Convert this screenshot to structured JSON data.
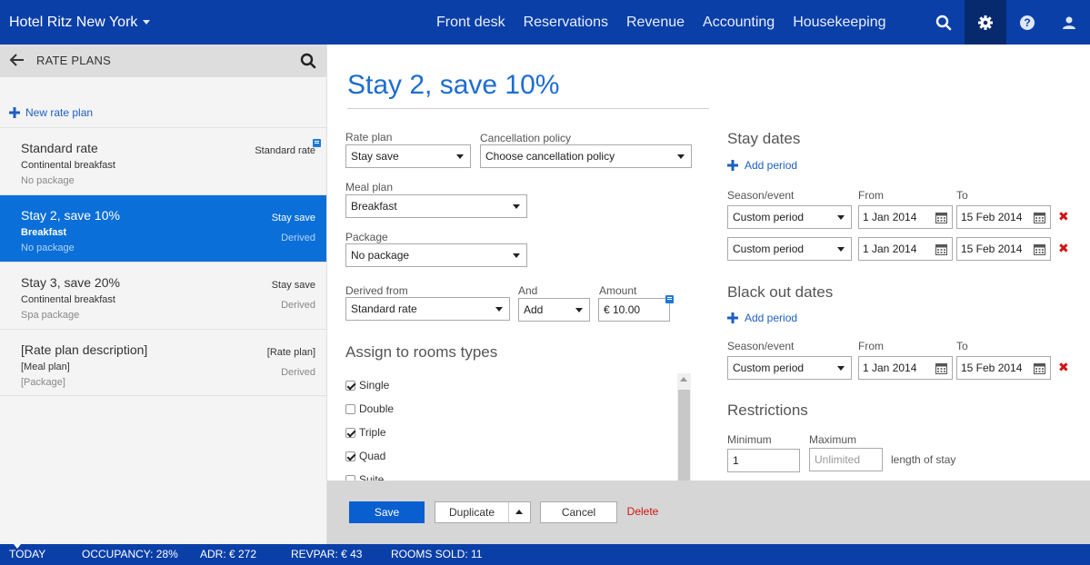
{
  "topbar": {
    "hotel": "Hotel Ritz New York",
    "nav": [
      "Front desk",
      "Reservations",
      "Revenue",
      "Accounting",
      "Housekeeping"
    ],
    "icons": [
      "search-icon",
      "gear-icon",
      "help-icon",
      "user-icon"
    ]
  },
  "left": {
    "title": "RATE PLANS",
    "new_plan": "New rate plan",
    "items": [
      {
        "name": "Standard rate",
        "line2": "Continental breakfast",
        "line3": "No package",
        "right1": "Standard rate",
        "right2": ""
      },
      {
        "name": "Stay 2, save 10%",
        "line2": "Breakfast",
        "line3": "No package",
        "right1": "Stay save",
        "right2": "Derived"
      },
      {
        "name": "Stay 3, save 20%",
        "line2": "Continental breakfast",
        "line3": "Spa package",
        "right1": "Stay save",
        "right2": "Derived"
      },
      {
        "name": "[Rate plan description]",
        "line2": "[Meal plan]",
        "line3": "[Package]",
        "right1": "[Rate plan]",
        "right2": "Derived"
      }
    ]
  },
  "form": {
    "title": "Stay 2, save 10%",
    "rate_plan_label": "Rate plan",
    "rate_plan_value": "Stay save",
    "cancellation_label": "Cancellation policy",
    "cancellation_value": "Choose cancellation policy",
    "meal_plan_label": "Meal plan",
    "meal_plan_value": "Breakfast",
    "package_label": "Package",
    "package_value": "No package",
    "derived_from_label": "Derived from",
    "derived_from_value": "Standard rate",
    "and_label": "And",
    "and_value": "Add",
    "amount_label": "Amount",
    "amount_value": "€ 10.00",
    "rooms_title": "Assign to rooms types",
    "rooms": [
      {
        "name": "Single",
        "checked": true
      },
      {
        "name": "Double",
        "checked": false
      },
      {
        "name": "Triple",
        "checked": true
      },
      {
        "name": "Quad",
        "checked": true
      },
      {
        "name": "Suite",
        "checked": false
      }
    ]
  },
  "stay_dates": {
    "title": "Stay dates",
    "add_period": "Add period",
    "season_label": "Season/event",
    "from_label": "From",
    "to_label": "To",
    "rows": [
      {
        "season": "Custom period",
        "from": "1 Jan 2014",
        "to": "15 Feb 2014"
      },
      {
        "season": "Custom period",
        "from": "1 Jan 2014",
        "to": "15 Feb 2014"
      }
    ]
  },
  "blackout": {
    "title": "Black out dates",
    "add_period": "Add period",
    "season_label": "Season/event",
    "from_label": "From",
    "to_label": "To",
    "rows": [
      {
        "season": "Custom period",
        "from": "1 Jan 2014",
        "to": "15 Feb 2014"
      }
    ]
  },
  "restrictions": {
    "title": "Restrictions",
    "min_label": "Minimum",
    "min_value": "1",
    "max_label": "Maximum",
    "max_placeholder": "Unlimited",
    "suffix": "length of stay"
  },
  "actions": {
    "save": "Save",
    "duplicate": "Duplicate",
    "cancel": "Cancel",
    "delete": "Delete"
  },
  "status": {
    "today": "TODAY",
    "occupancy": "OCCUPANCY: 28%",
    "adr": "ADR: € 272",
    "revpar": "REVPAR: € 43",
    "rooms_sold": "ROOMS SOLD: 11"
  },
  "colors": {
    "brand": "#0b3fa8",
    "accent": "#0a6fd8",
    "delete": "#d01414"
  }
}
